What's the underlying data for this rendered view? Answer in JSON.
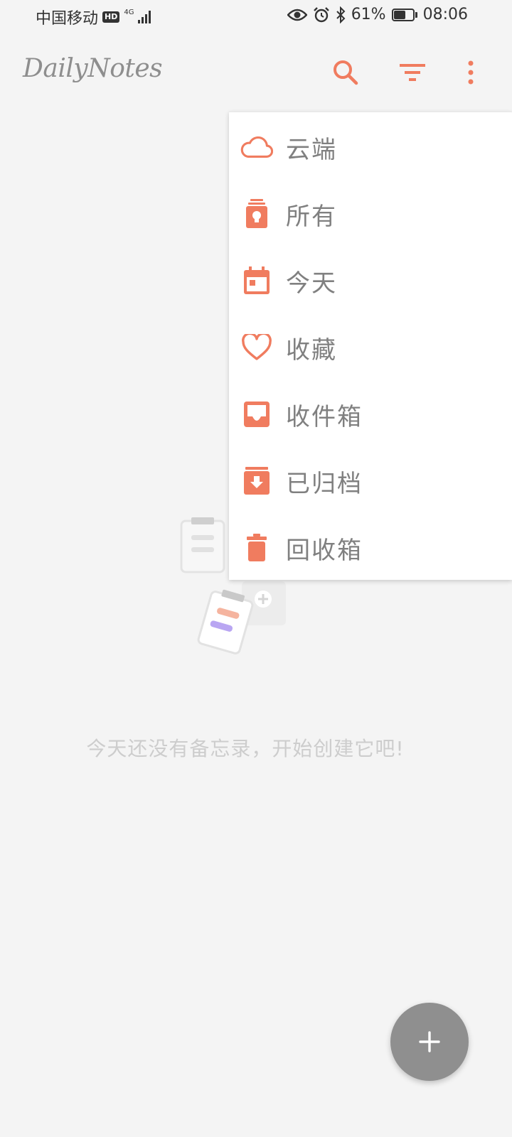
{
  "status_bar": {
    "carrier": "中国移动",
    "hd_badge": "HD",
    "network_type": "4G",
    "battery_percent": "61%",
    "battery_level": 0.61,
    "time": "08:06",
    "icons": [
      "eye-icon",
      "alarm-icon",
      "bluetooth-icon",
      "battery-icon"
    ]
  },
  "app_bar": {
    "title": "DailyNotes",
    "actions": [
      "search-icon",
      "filter-icon",
      "more-vert-icon"
    ]
  },
  "menu": {
    "items": [
      {
        "label": "云端",
        "icon": "cloud-icon"
      },
      {
        "label": "所有",
        "icon": "all-notes-icon"
      },
      {
        "label": "今天",
        "icon": "calendar-today-icon"
      },
      {
        "label": "收藏",
        "icon": "heart-icon"
      },
      {
        "label": "收件箱",
        "icon": "inbox-icon"
      },
      {
        "label": "已归档",
        "icon": "archive-icon"
      },
      {
        "label": "回收箱",
        "icon": "trash-icon"
      }
    ]
  },
  "empty_state": {
    "message": "今天还没有备忘录，开始创建它吧!"
  },
  "fab": {
    "icon": "plus-icon"
  },
  "colors": {
    "accent": "#F07C5F",
    "background": "#F4F4F4",
    "menu_text": "#808080",
    "fab": "#8F8F8F",
    "illustration_purple": "#B9A6F2",
    "illustration_peach": "#F5B49F"
  }
}
